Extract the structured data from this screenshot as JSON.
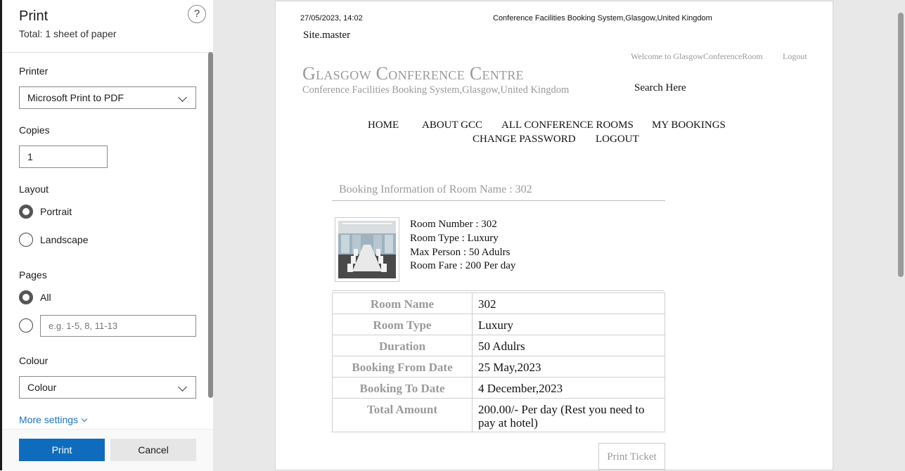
{
  "panel": {
    "title": "Print",
    "subtitle": "Total: 1 sheet of paper",
    "help_glyph": "?",
    "printer_label": "Printer",
    "printer_value": "Microsoft Print to PDF",
    "copies_label": "Copies",
    "copies_value": "1",
    "layout_label": "Layout",
    "layout_options": [
      "Portrait",
      "Landscape"
    ],
    "layout_selected": "Portrait",
    "pages_label": "Pages",
    "pages_all": "All",
    "pages_placeholder": "e.g. 1-5, 8, 11-13",
    "pages_selected": "All",
    "colour_label": "Colour",
    "colour_value": "Colour",
    "more_settings": "More settings",
    "print_button": "Print",
    "cancel_button": "Cancel"
  },
  "preview": {
    "header_date": "27/05/2023, 14:02",
    "header_title": "Conference Facilities Booking System,Glasgow,United Kingdom",
    "site_master": "Site.master",
    "welcome": "Welcome to GlasgowConferenceRoom",
    "logout_top": "Logout",
    "brand": "Glasgow Conference Centre",
    "brand_sub": "Conference Facilities Booking System,Glasgow,United Kingdom",
    "search": "Search Here",
    "nav": [
      "HOME",
      "ABOUT GCC",
      "ALL CONFERENCE ROOMS",
      "MY BOOKINGS",
      "CHANGE PASSWORD",
      "LOGOUT"
    ],
    "section_title": "Booking Information of Room Name : 302",
    "room_info": [
      "Room Number : 302",
      "Room Type : Luxury",
      "Max Person : 50 Adulrs",
      "Room Fare : 200 Per day"
    ],
    "table": [
      {
        "k": "Room Name",
        "v": "302"
      },
      {
        "k": "Room Type",
        "v": "Luxury"
      },
      {
        "k": "Duration",
        "v": "50 Adulrs"
      },
      {
        "k": "Booking From Date",
        "v": "25 May,2023"
      },
      {
        "k": "Booking To Date",
        "v": "4 December,2023"
      },
      {
        "k": "Total Amount",
        "v": "200.00/- Per day (Rest you need to pay at hotel)"
      }
    ],
    "print_ticket": "Print Ticket"
  },
  "colors": {
    "accent": "#0f6cbd",
    "link": "#1a73c9",
    "muted_text": "#999999"
  }
}
